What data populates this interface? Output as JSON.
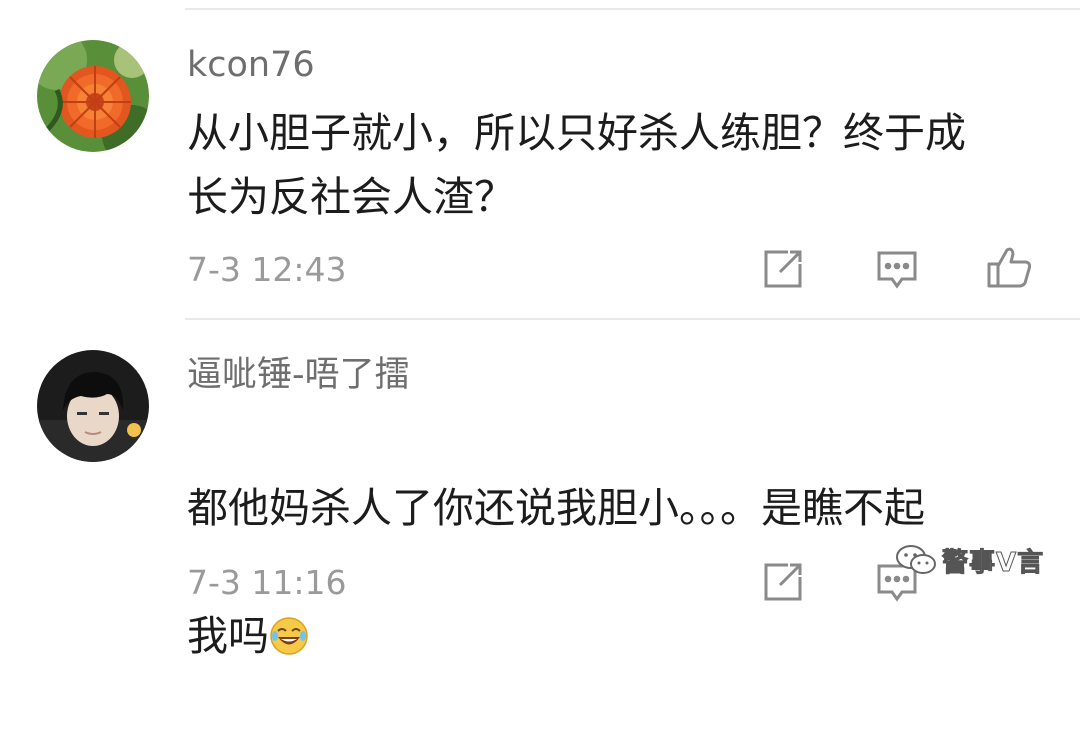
{
  "comments": [
    {
      "username": "kcon76",
      "text": "从小胆子就小，所以只好杀人练胆？终于成\n长为反社会人渣？",
      "time": "7-3 12:43"
    },
    {
      "username": "逼呲锤-唔了擂",
      "text_line1": "都他妈杀人了你还说我胆小。。。是瞧不起",
      "text_line2": "我吗",
      "emoji": "laughing-crying-emoji",
      "time": "7-3 11:16"
    }
  ],
  "icons": {
    "repost": "repost-icon",
    "comment": "comment-icon",
    "like": "thumbs-up-icon"
  },
  "watermark": {
    "text": "警事V言",
    "icon": "wechat-icon"
  },
  "colors": {
    "username": "#6e6e6e",
    "text": "#1c1c1c",
    "time": "#9a9a9a",
    "icon": "#8a8a8a",
    "divider": "#e9e9e9"
  }
}
